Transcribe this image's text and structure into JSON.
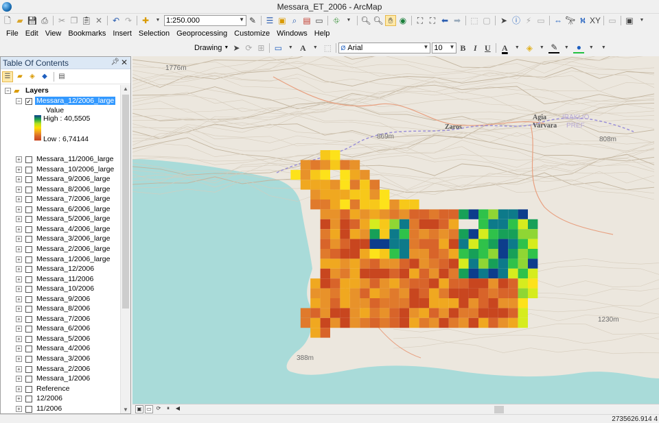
{
  "window": {
    "title": "Messara_ET_2006 - ArcMap"
  },
  "standard_toolbar": {
    "scale": "1:250.000"
  },
  "menu": [
    "File",
    "Edit",
    "View",
    "Bookmarks",
    "Insert",
    "Selection",
    "Geoprocessing",
    "Customize",
    "Windows",
    "Help"
  ],
  "drawing_toolbar": {
    "drawing_label": "Drawing",
    "font": "Arial",
    "font_size": "10",
    "bold": "B",
    "italic": "I",
    "underline": "U",
    "font_color_label": "A"
  },
  "toc": {
    "title": "Table Of Contents",
    "root": "Layers",
    "selected_layer": "Messara_12/2006_large",
    "legend": {
      "heading": "Value",
      "high": "High : 40,5505",
      "low": "Low : 6,74144",
      "colors": [
        "#0d3d8c",
        "#1fa34a",
        "#b7e21f",
        "#ffdf00",
        "#f0a020",
        "#d8642a",
        "#c8461f"
      ]
    },
    "layers": [
      "Messara_11/2006_large",
      "Messara_10/2006_large",
      "Messara_9/2006_large",
      "Messara_8/2006_large",
      "Messara_7/2006_large",
      "Messara_6/2006_large",
      "Messara_5/2006_large",
      "Messara_4/2006_large",
      "Messara_3/2006_large",
      "Messara_2/2006_large",
      "Messara_1/2006_large",
      "Messara_12/2006",
      "Messara_11/2006",
      "Messara_10/2006",
      "Messara_9/2006",
      "Messara_8/2006",
      "Messara_7/2006",
      "Messara_6/2006",
      "Messara_5/2006",
      "Messara_4/2006",
      "Messara_3/2006",
      "Messara_2/2006",
      "Messara_1/2006",
      "Reference",
      "12/2006",
      "11/2006"
    ]
  },
  "map": {
    "labels": {
      "elev_1776": "1776m",
      "zaros": "Zaros",
      "elev_869": "869m",
      "agia": "Agia",
      "varvara": "Varvara",
      "iraklio": "IRAKLIO",
      "pref": "PREF",
      "elev_808": "808m",
      "elev_1230": "1230m",
      "elev_388": "388m"
    },
    "colors": {
      "sea": "#a9dbd9",
      "land": "#ece7de",
      "contour": "#d3c8b6",
      "road": "#e8a080",
      "border": "#9a8fd8"
    }
  },
  "status": {
    "coords": "2735626.914  4"
  }
}
